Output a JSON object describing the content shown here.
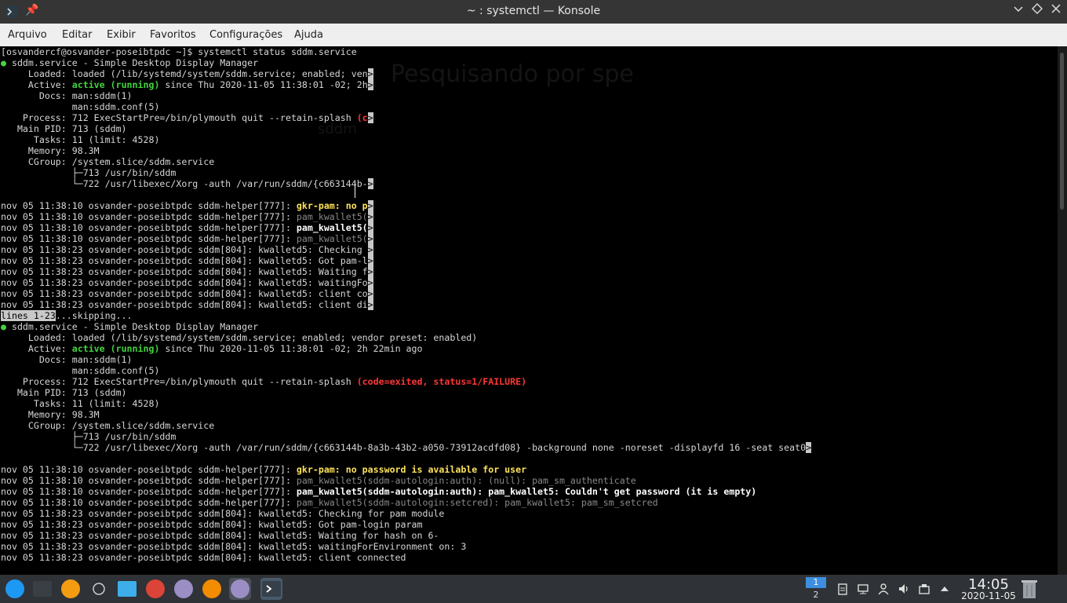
{
  "window": {
    "title": "~ : systemctl — Konsole",
    "buttons": [
      "minimize",
      "maximize",
      "close"
    ]
  },
  "menu": [
    "Arquivo",
    "Editar",
    "Exibir",
    "Favoritos",
    "Configurações",
    "Ajuda"
  ],
  "background_text": {
    "line1": "Pesquisando por spe",
    "line2": "sddm"
  },
  "terminal": {
    "lines": [
      [
        [
          "",
          "[osvandercf@osvander-poseibtpdc ~]$ systemctl status sddm.service"
        ]
      ],
      [
        [
          "g",
          "●"
        ],
        [
          "",
          " sddm.service - Simple Desktop Display Manager"
        ]
      ],
      [
        [
          "",
          "     Loaded: loaded (/lib/systemd/system/sddm.service; enabled; ven"
        ],
        [
          "cur",
          ">"
        ]
      ],
      [
        [
          "",
          "     Active: "
        ],
        [
          "gb",
          "active (running)"
        ],
        [
          "",
          " since Thu 2020-11-05 11:38:01 -02; 2h"
        ],
        [
          "cur",
          ">"
        ]
      ],
      [
        [
          "",
          "       Docs: man:sddm(1)"
        ]
      ],
      [
        [
          "",
          "             man:sddm.conf(5)"
        ]
      ],
      [
        [
          "",
          "    Process: 712 ExecStartPre=/bin/plymouth quit --retain-splash "
        ],
        [
          "rb",
          "(c"
        ],
        [
          "cur",
          ">"
        ]
      ],
      [
        [
          "",
          "   Main PID: 713 (sddm)"
        ]
      ],
      [
        [
          "",
          "      Tasks: 11 (limit: 4528)"
        ]
      ],
      [
        [
          "",
          "     Memory: 98.3M"
        ]
      ],
      [
        [
          "",
          "     CGroup: /system.slice/sddm.service"
        ]
      ],
      [
        [
          "",
          "             ├─713 /usr/bin/sddm"
        ]
      ],
      [
        [
          "",
          "             └─722 /usr/libexec/Xorg -auth /var/run/sddm/{c663144b-"
        ],
        [
          "cur",
          ">"
        ]
      ],
      [
        [
          "",
          ""
        ]
      ],
      [
        [
          "",
          "nov 05 11:38:10 osvander-poseibtpdc sddm-helper[777]: "
        ],
        [
          "yb",
          "gkr-pam: no p"
        ],
        [
          "cur",
          ">"
        ]
      ],
      [
        [
          "",
          "nov 05 11:38:10 osvander-poseibtpdc sddm-helper[777]: "
        ],
        [
          "dim",
          "pam_kwallet5("
        ],
        [
          "cur",
          ">"
        ]
      ],
      [
        [
          "",
          "nov 05 11:38:10 osvander-poseibtpdc sddm-helper[777]: "
        ],
        [
          "wb",
          "pam_kwallet5("
        ],
        [
          "cur",
          ">"
        ]
      ],
      [
        [
          "",
          "nov 05 11:38:10 osvander-poseibtpdc sddm-helper[777]: "
        ],
        [
          "dim",
          "pam_kwallet5("
        ],
        [
          "cur",
          ">"
        ]
      ],
      [
        [
          "",
          "nov 05 11:38:23 osvander-poseibtpdc sddm[804]: kwalletd5: Checking "
        ],
        [
          "cur",
          ">"
        ]
      ],
      [
        [
          "",
          "nov 05 11:38:23 osvander-poseibtpdc sddm[804]: kwalletd5: Got pam-l"
        ],
        [
          "cur",
          ">"
        ]
      ],
      [
        [
          "",
          "nov 05 11:38:23 osvander-poseibtpdc sddm[804]: kwalletd5: Waiting f"
        ],
        [
          "cur",
          ">"
        ]
      ],
      [
        [
          "",
          "nov 05 11:38:23 osvander-poseibtpdc sddm[804]: kwalletd5: waitingFo"
        ],
        [
          "cur",
          ">"
        ]
      ],
      [
        [
          "",
          "nov 05 11:38:23 osvander-poseibtpdc sddm[804]: kwalletd5: client co"
        ],
        [
          "cur",
          ">"
        ]
      ],
      [
        [
          "",
          "nov 05 11:38:23 osvander-poseibtpdc sddm[804]: kwalletd5: client di"
        ],
        [
          "cur",
          ">"
        ]
      ],
      [
        [
          "inv",
          "lines 1-23"
        ],
        [
          "",
          "...skipping..."
        ]
      ],
      [
        [
          "g",
          "●"
        ],
        [
          "",
          " sddm.service - Simple Desktop Display Manager"
        ]
      ],
      [
        [
          "",
          "     Loaded: loaded (/lib/systemd/system/sddm.service; enabled; vendor preset: enabled)"
        ]
      ],
      [
        [
          "",
          "     Active: "
        ],
        [
          "gb",
          "active (running)"
        ],
        [
          "",
          " since Thu 2020-11-05 11:38:01 -02; 2h 22min ago"
        ]
      ],
      [
        [
          "",
          "       Docs: man:sddm(1)"
        ]
      ],
      [
        [
          "",
          "             man:sddm.conf(5)"
        ]
      ],
      [
        [
          "",
          "    Process: 712 ExecStartPre=/bin/plymouth quit --retain-splash "
        ],
        [
          "rb",
          "(code=exited, status=1/FAILURE)"
        ]
      ],
      [
        [
          "",
          "   Main PID: 713 (sddm)"
        ]
      ],
      [
        [
          "",
          "      Tasks: 11 (limit: 4528)"
        ]
      ],
      [
        [
          "",
          "     Memory: 98.3M"
        ]
      ],
      [
        [
          "",
          "     CGroup: /system.slice/sddm.service"
        ]
      ],
      [
        [
          "",
          "             ├─713 /usr/bin/sddm"
        ]
      ],
      [
        [
          "",
          "             └─722 /usr/libexec/Xorg -auth /var/run/sddm/{c663144b-8a3b-43b2-a050-73912acdfd08} -background none -noreset -displayfd 16 -seat seat0"
        ],
        [
          "cur",
          ">"
        ]
      ],
      [
        [
          "",
          ""
        ]
      ],
      [
        [
          "",
          "nov 05 11:38:10 osvander-poseibtpdc sddm-helper[777]: "
        ],
        [
          "yb",
          "gkr-pam: no password is available for user"
        ]
      ],
      [
        [
          "",
          "nov 05 11:38:10 osvander-poseibtpdc sddm-helper[777]: "
        ],
        [
          "dim",
          "pam_kwallet5(sddm-autologin:auth): (null): pam_sm_authenticate"
        ]
      ],
      [
        [
          "",
          "nov 05 11:38:10 osvander-poseibtpdc sddm-helper[777]: "
        ],
        [
          "wb",
          "pam_kwallet5(sddm-autologin:auth): pam_kwallet5: Couldn't get password (it is empty)"
        ]
      ],
      [
        [
          "",
          "nov 05 11:38:10 osvander-poseibtpdc sddm-helper[777]: "
        ],
        [
          "dim",
          "pam_kwallet5(sddm-autologin:setcred): pam_kwallet5: pam_sm_setcred"
        ]
      ],
      [
        [
          "",
          "nov 05 11:38:23 osvander-poseibtpdc sddm[804]: kwalletd5: Checking for pam module"
        ]
      ],
      [
        [
          "",
          "nov 05 11:38:23 osvander-poseibtpdc sddm[804]: kwalletd5: Got pam-login param"
        ]
      ],
      [
        [
          "",
          "nov 05 11:38:23 osvander-poseibtpdc sddm[804]: kwalletd5: Waiting for hash on 6-"
        ]
      ],
      [
        [
          "",
          "nov 05 11:38:23 osvander-poseibtpdc sddm[804]: kwalletd5: waitingForEnvironment on: 3"
        ]
      ],
      [
        [
          "",
          "nov 05 11:38:23 osvander-poseibtpdc sddm[804]: kwalletd5: client connected"
        ]
      ]
    ]
  },
  "taskbar": {
    "apps": [
      {
        "name": "application-launcher-icon",
        "color": "#1d99f3"
      },
      {
        "name": "system-monitor-icon",
        "color": "#3a3f45"
      },
      {
        "name": "amarok-icon",
        "color": "#f39c12"
      },
      {
        "name": "clipboard-icon",
        "color": "#2f3236"
      },
      {
        "name": "file-manager-icon",
        "color": "#3daee9"
      },
      {
        "name": "chrome-icon",
        "color": "#db4437"
      },
      {
        "name": "kvantum-icon",
        "color": "#9b8ec4"
      },
      {
        "name": "vlc-icon",
        "color": "#f28c00"
      },
      {
        "name": "discover-icon",
        "color": "#9b8ec4"
      },
      {
        "name": "konsole-icon",
        "color": "#36404b"
      }
    ],
    "pager": {
      "desktop1": "1",
      "desktop2": "2"
    },
    "clock": {
      "time": "14:05",
      "date": "2020-11-05"
    },
    "colors": {
      "panel": "#2f3236",
      "pager_active": "#3d8ee0"
    }
  }
}
